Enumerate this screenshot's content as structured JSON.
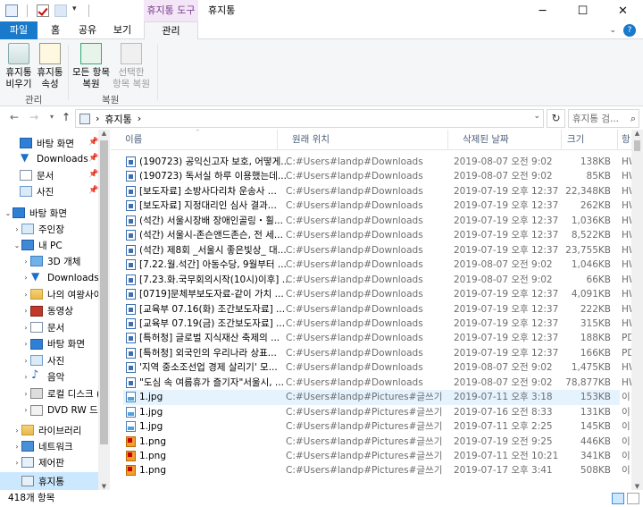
{
  "window": {
    "context_tab": "휴지통 도구",
    "title": "휴지통"
  },
  "ribbon_tabs": [
    "파일",
    "홈",
    "공유",
    "보기",
    "관리"
  ],
  "ribbon": {
    "empty_bin": [
      "휴지통",
      "비우기"
    ],
    "bin_props": [
      "휴지통",
      "속성"
    ],
    "group_manage": "관리",
    "restore_all": [
      "모든 항목",
      "복원"
    ],
    "restore_selected": [
      "선택한",
      "항목 복원"
    ],
    "group_restore": "복원"
  },
  "address": {
    "sep": "›",
    "location": "휴지통",
    "search_placeholder": "휴지통 검..."
  },
  "nav": {
    "quick": [
      {
        "label": "바탕 화면",
        "icon": "blue"
      },
      {
        "label": "Downloads",
        "icon": "dl"
      },
      {
        "label": "문서",
        "icon": "doc"
      },
      {
        "label": "사진",
        "icon": "pict"
      }
    ],
    "desktop": "바탕 화면",
    "user": "주인장",
    "pc": "내 PC",
    "pc_children": [
      {
        "label": "3D 개체",
        "icon": "obj3"
      },
      {
        "label": "Downloads",
        "icon": "dl"
      },
      {
        "label": "나의 여왕사이...",
        "icon": "folder"
      },
      {
        "label": "동영상",
        "icon": "vid"
      },
      {
        "label": "문서",
        "icon": "doc"
      },
      {
        "label": "바탕 화면",
        "icon": "blue"
      },
      {
        "label": "사진",
        "icon": "pict"
      },
      {
        "label": "음악",
        "icon": "mus"
      },
      {
        "label": "로컬 디스크 (C",
        "icon": "drv"
      },
      {
        "label": "DVD RW 드라",
        "icon": "dvd"
      }
    ],
    "libraries": "라이브러리",
    "network": "네트워크",
    "control": "제어판",
    "bin": "휴지통"
  },
  "columns": [
    "이름",
    "원래 위치",
    "삭제된 날짜",
    "크기",
    "항"
  ],
  "files": [
    {
      "name": "(190723) 공익신고자 보호, 어떻게...",
      "loc": "C:#Users#landp#Downloads",
      "date": "2019-08-07 오전 9:02",
      "size": "138KB",
      "type": "HW",
      "icon": "hwp"
    },
    {
      "name": "(190723) 독서실 하루 이용했는데...",
      "loc": "C:#Users#landp#Downloads",
      "date": "2019-08-07 오전 9:02",
      "size": "85KB",
      "type": "HW",
      "icon": "hwp"
    },
    {
      "name": "[보도자료] 소방사다리차 운송사 ...",
      "loc": "C:#Users#landp#Downloads",
      "date": "2019-07-19 오후 12:37",
      "size": "22,348KB",
      "type": "HW",
      "icon": "hwp"
    },
    {
      "name": "[보도자료] 지정대리인 심사 결과...",
      "loc": "C:#Users#landp#Downloads",
      "date": "2019-07-19 오후 12:37",
      "size": "262KB",
      "type": "HW",
      "icon": "hwp"
    },
    {
      "name": "(석간) 서울시장배 장애인골링・휠...",
      "loc": "C:#Users#landp#Downloads",
      "date": "2019-07-19 오후 12:37",
      "size": "1,036KB",
      "type": "HW",
      "icon": "hwp"
    },
    {
      "name": "(석간) 서울시-존슨앤드존슨, 전 세...",
      "loc": "C:#Users#landp#Downloads",
      "date": "2019-07-19 오후 12:37",
      "size": "8,522KB",
      "type": "HW",
      "icon": "hwp"
    },
    {
      "name": "(석간) 제8회 _서울시 좋은빛상_ 대...",
      "loc": "C:#Users#landp#Downloads",
      "date": "2019-07-19 오후 12:37",
      "size": "23,755KB",
      "type": "HW",
      "icon": "hwp"
    },
    {
      "name": "[7.22.월.석간] 아동수당, 9월부터 ...",
      "loc": "C:#Users#landp#Downloads",
      "date": "2019-08-07 오전 9:02",
      "size": "1,046KB",
      "type": "HW",
      "icon": "hwp"
    },
    {
      "name": "[7.23.화.국무회의시작(10시)이후] ...",
      "loc": "C:#Users#landp#Downloads",
      "date": "2019-08-07 오전 9:02",
      "size": "66KB",
      "type": "HW",
      "icon": "hwp"
    },
    {
      "name": "[0719]문체부보도자료-같이 가치 ...",
      "loc": "C:#Users#landp#Downloads",
      "date": "2019-07-19 오후 12:37",
      "size": "4,091KB",
      "type": "HW",
      "icon": "hwp"
    },
    {
      "name": "[교육부 07.16(화) 조간보도자료] ...",
      "loc": "C:#Users#landp#Downloads",
      "date": "2019-07-19 오후 12:37",
      "size": "222KB",
      "type": "HW",
      "icon": "hwp"
    },
    {
      "name": "[교육부 07.19(금) 조간보도자료] ...",
      "loc": "C:#Users#landp#Downloads",
      "date": "2019-07-19 오후 12:37",
      "size": "315KB",
      "type": "HW",
      "icon": "hwp"
    },
    {
      "name": "[특허청] 글로벌 지식재산 축제의 ...",
      "loc": "C:#Users#landp#Downloads",
      "date": "2019-07-19 오후 12:37",
      "size": "188KB",
      "type": "PD",
      "icon": "hwp"
    },
    {
      "name": "[특허청] 외국인의 우리나라 상표...",
      "loc": "C:#Users#landp#Downloads",
      "date": "2019-07-19 오후 12:37",
      "size": "166KB",
      "type": "PD",
      "icon": "hwp"
    },
    {
      "name": "'지역 중소조선업 경제 살리기' 모...",
      "loc": "C:#Users#landp#Downloads",
      "date": "2019-08-07 오전 9:02",
      "size": "1,475KB",
      "type": "HW",
      "icon": "hwp"
    },
    {
      "name": "\"도심 속 여름휴가 즐기자\"서울시, ...",
      "loc": "C:#Users#landp#Downloads",
      "date": "2019-08-07 오전 9:02",
      "size": "78,877KB",
      "type": "HW",
      "icon": "hwp"
    },
    {
      "name": "1.jpg",
      "loc": "C:#Users#landp#Pictures#글쓰기",
      "date": "2019-07-11 오후 3:18",
      "size": "153KB",
      "type": "이",
      "icon": "jpg"
    },
    {
      "name": "1.jpg",
      "loc": "C:#Users#landp#Pictures#글쓰기",
      "date": "2019-07-16 오전 8:33",
      "size": "131KB",
      "type": "이",
      "icon": "jpg"
    },
    {
      "name": "1.jpg",
      "loc": "C:#Users#landp#Pictures#글쓰기",
      "date": "2019-07-11 오후 2:25",
      "size": "145KB",
      "type": "이",
      "icon": "jpg"
    },
    {
      "name": "1.png",
      "loc": "C:#Users#landp#Pictures#글쓰기",
      "date": "2019-07-19 오전 9:25",
      "size": "446KB",
      "type": "이",
      "icon": "png"
    },
    {
      "name": "1.png",
      "loc": "C:#Users#landp#Pictures#글쓰기",
      "date": "2019-07-11 오전 10:21",
      "size": "341KB",
      "type": "이",
      "icon": "png"
    },
    {
      "name": "1.png",
      "loc": "C:#Users#landp#Pictures#글쓰기",
      "date": "2019-07-17 오후 3:41",
      "size": "508KB",
      "type": "이",
      "icon": "png"
    }
  ],
  "status": "418개 항목"
}
